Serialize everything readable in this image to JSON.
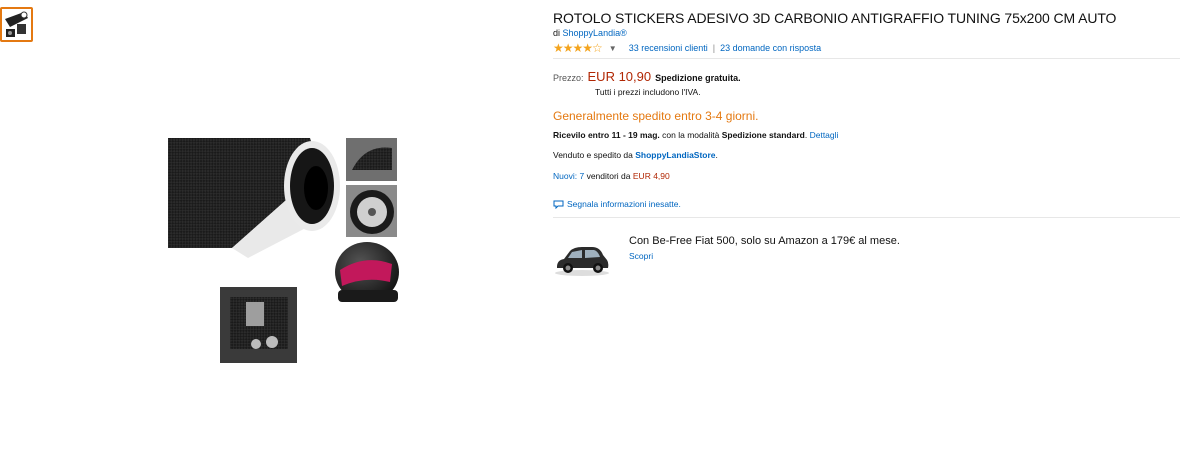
{
  "product": {
    "title": "ROTOLO STICKERS ADESIVO 3D CARBONIO ANTIGRAFFIO TUNING 75x200 CM AUTO",
    "by_prefix": "di",
    "brand": "ShoppyLandia®",
    "stars": "★★★★☆",
    "reviews": "33 recensioni clienti",
    "separator": "|",
    "questions": "23 domande con risposta"
  },
  "pricing": {
    "label": "Prezzo:",
    "price": "EUR 10,90",
    "shipping": "Spedizione gratuita.",
    "vat_note": "Tutti i prezzi includono l'IVA."
  },
  "availability": "Generalmente spedito entro 3-4 giorni.",
  "delivery": {
    "prefix": "Ricevilo entro",
    "dates": "11 - 19 mag.",
    "middle": "con la modalità",
    "method": "Spedizione standard",
    "dot": ".",
    "details_link": "Dettagli"
  },
  "seller": {
    "prefix": "Venduto e spedito da",
    "name": "ShoppyLandiaStore",
    "suffix": "."
  },
  "offers": {
    "new_label": "Nuovi: 7",
    "middle": "venditori da",
    "low_price": "EUR 4,90"
  },
  "report_link": "Segnala informazioni inesatte.",
  "promo": {
    "text": "Con Be-Free Fiat 500, solo su Amazon a 179€ al mese.",
    "link": "Scopri"
  },
  "colors": {
    "link": "#0066c0",
    "price": "#b12704",
    "accent": "#e47911",
    "star": "#f4a41e"
  }
}
